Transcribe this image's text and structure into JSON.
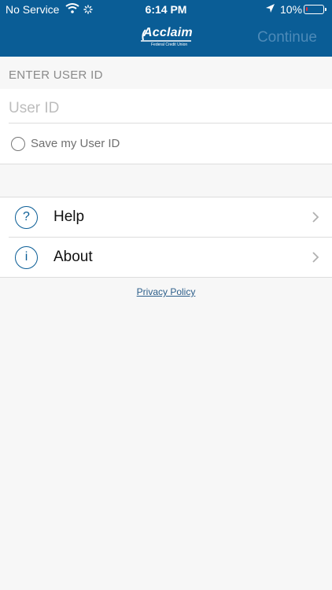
{
  "status_bar": {
    "carrier": "No Service",
    "time": "6:14 PM",
    "battery_pct": "10%"
  },
  "header": {
    "logo_text": "Acclaim",
    "logo_subtext": "Federal Credit Union",
    "continue_label": "Continue"
  },
  "form": {
    "section_label": "ENTER USER ID",
    "userid_placeholder": "User ID",
    "userid_value": "",
    "save_label": "Save my User ID"
  },
  "menu": {
    "items": [
      {
        "label": "Help",
        "icon": "question-icon",
        "icon_glyph": "?"
      },
      {
        "label": "About",
        "icon": "info-icon",
        "icon_glyph": "i"
      }
    ]
  },
  "footer": {
    "privacy_label": "Privacy Policy"
  },
  "colors": {
    "header_bg": "#0a5d96",
    "continue_disabled": "#4d8ab8",
    "battery_low": "#e0303a",
    "link": "#2c5e8a"
  }
}
